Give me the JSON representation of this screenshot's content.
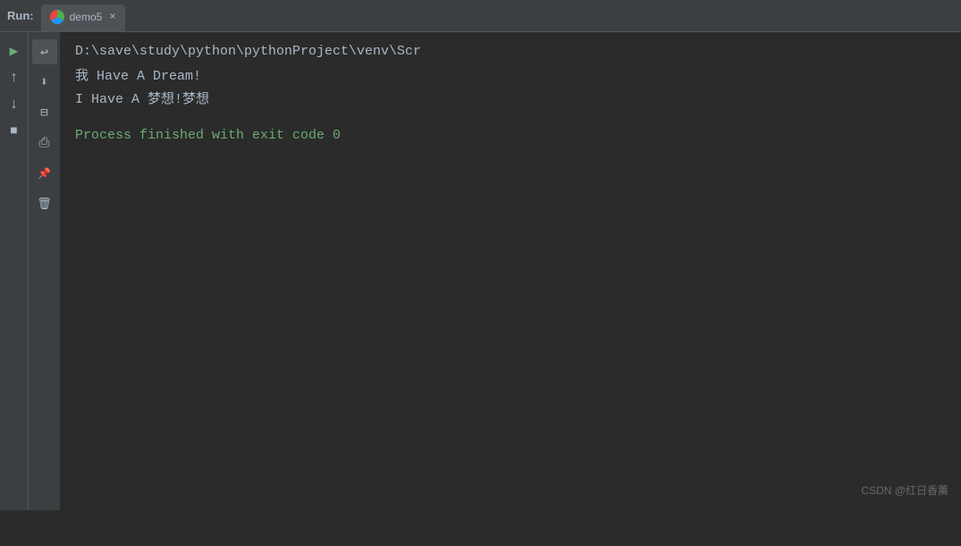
{
  "topBar": {
    "runLabel": "Run:",
    "tab": {
      "name": "demo5",
      "closeLabel": "×"
    }
  },
  "toolbar": {
    "buttons": [
      {
        "name": "play",
        "icon": "play-icon",
        "label": "Run"
      },
      {
        "name": "up",
        "icon": "up-icon",
        "label": "Scroll Up"
      },
      {
        "name": "down",
        "icon": "down-icon",
        "label": "Scroll Down"
      },
      {
        "name": "stop",
        "icon": "stop-icon",
        "label": "Stop"
      },
      {
        "name": "wrap",
        "icon": "wrap-icon",
        "label": "Soft Wrap"
      },
      {
        "name": "import",
        "icon": "import-icon",
        "label": "Import"
      },
      {
        "name": "layers",
        "icon": "layers-icon",
        "label": "Layers"
      },
      {
        "name": "print",
        "icon": "print-icon",
        "label": "Print"
      },
      {
        "name": "pin",
        "icon": "pin-icon",
        "label": "Pin"
      },
      {
        "name": "trash",
        "icon": "trash-icon",
        "label": "Clear"
      }
    ]
  },
  "console": {
    "lines": [
      {
        "text": "D:\\save\\study\\python\\pythonProject\\venv\\Scr",
        "type": "path-line"
      },
      {
        "text": "我 Have A Dream!",
        "type": "output-line"
      },
      {
        "text": "I Have A 梦想!梦想",
        "type": "output-line"
      },
      {
        "text": "",
        "type": "output-line"
      },
      {
        "text": "Process finished with exit code 0",
        "type": "process-line"
      }
    ]
  },
  "watermark": {
    "text": "CSDN @红日香薰"
  }
}
